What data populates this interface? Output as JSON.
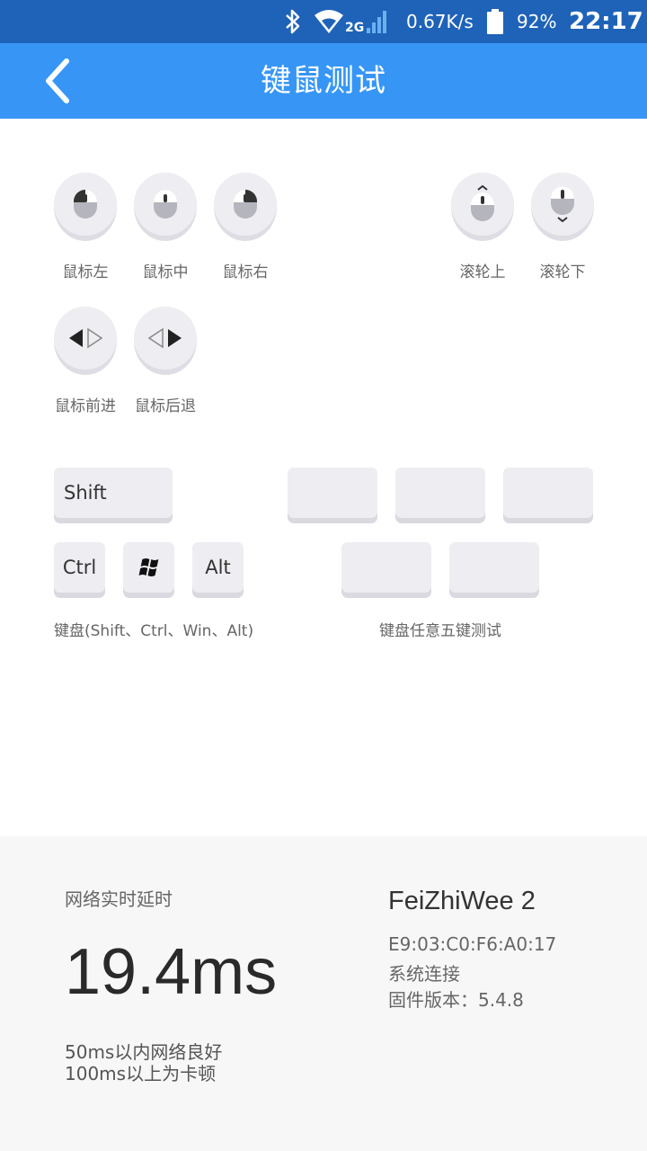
{
  "status_bar": {
    "network_type": "2G",
    "speed": "0.67K/s",
    "battery_pct": "92%",
    "time": "22:17",
    "icons": [
      "bluetooth-icon",
      "wifi-icon",
      "signal-icon",
      "battery-icon"
    ]
  },
  "app_bar": {
    "title": "键鼠测试",
    "back_icon": "chevron-left-icon"
  },
  "mouse": {
    "left": "鼠标左",
    "middle": "鼠标中",
    "right": "鼠标右",
    "scroll_up": "滚轮上",
    "scroll_down": "滚轮下",
    "forward": "鼠标前进",
    "back": "鼠标后退"
  },
  "keyboard": {
    "shift": "Shift",
    "ctrl": "Ctrl",
    "alt": "Alt",
    "win_icon": "windows-logo-icon",
    "modifiers_label": "键盘(Shift、Ctrl、Win、Alt)",
    "any_keys_label": "键盘任意五键测试",
    "any_keys": [
      "",
      "",
      "",
      "",
      ""
    ]
  },
  "latency": {
    "title": "网络实时延时",
    "value": "19.4ms",
    "note_1": "50ms以内网络良好",
    "note_2": "100ms以上为卡顿"
  },
  "device": {
    "name": "FeiZhiWee 2",
    "mac": "E9:03:C0:F6:A0:17",
    "connection": "系统连接",
    "firmware": "固件版本：5.4.8"
  },
  "colors": {
    "status_bar": "#1f63b8",
    "app_bar": "#3796f5",
    "button_face": "#eeeef2",
    "panel": "#f7f7f7"
  }
}
